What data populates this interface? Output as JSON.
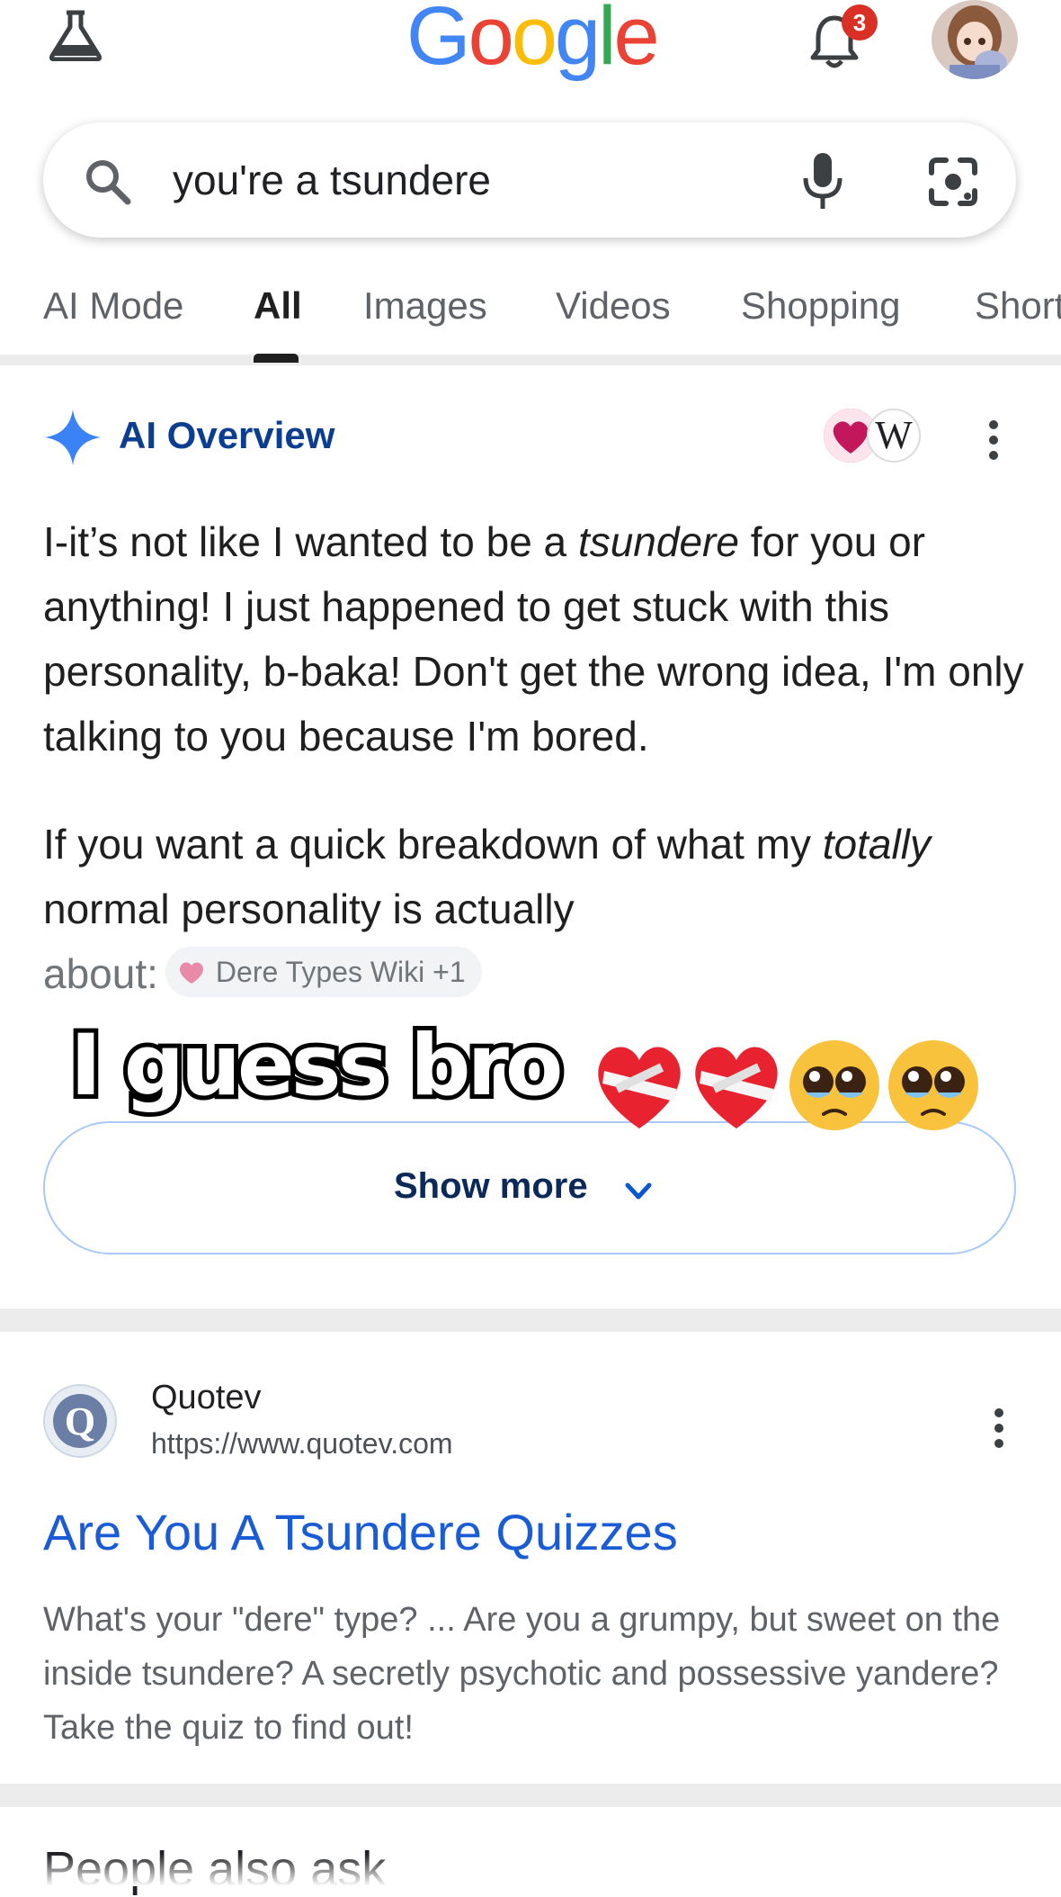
{
  "header": {
    "logo_letters": [
      {
        "ch": "G",
        "color": "#4285F4"
      },
      {
        "ch": "o",
        "color": "#EA4335"
      },
      {
        "ch": "o",
        "color": "#FBBC05"
      },
      {
        "ch": "g",
        "color": "#4285F4"
      },
      {
        "ch": "l",
        "color": "#34A853"
      },
      {
        "ch": "e",
        "color": "#EA4335"
      }
    ],
    "notification_count": "3",
    "icons": [
      "labs-flask-icon",
      "bell-icon",
      "avatar"
    ]
  },
  "search": {
    "query": "you're a tsundere",
    "icons": [
      "search-icon",
      "mic-icon",
      "lens-icon"
    ]
  },
  "tabs": [
    {
      "label": "AI Mode",
      "active": false
    },
    {
      "label": "All",
      "active": true
    },
    {
      "label": "Images",
      "active": false
    },
    {
      "label": "Videos",
      "active": false
    },
    {
      "label": "Shopping",
      "active": false
    },
    {
      "label": "Short",
      "active": false
    }
  ],
  "ai_overview": {
    "title": "AI Overview",
    "source_logo2_letter": "W",
    "p1_a": "I-it’s not like I wanted to be a ",
    "p1_em": "tsundere",
    "p1_b": " for you or anything! I just happened to get stuck with this personality, b-baka! Don't get the wrong idea, I'm only talking to you because I'm bored.",
    "p2_a": "If you want a quick breakdown of what my ",
    "p2_em": "totally",
    "p2_b": " normal personality is actually",
    "p2_about": "about:",
    "source_chip": "Dere Types Wiki +1",
    "show_more": "Show more"
  },
  "overlay_caption": "I guess bro",
  "result": {
    "site_name": "Quotev",
    "url": "https://www.quotev.com",
    "favicon_letter": "Q",
    "title": "Are You A Tsundere Quizzes",
    "snippet": "What's your \"dere\" type? ... Are you a grumpy, but sweet on the inside tsundere? A secretly psychotic and possessive yandere? Take the quiz to find out!"
  },
  "next_section_heading": "People also ask",
  "colors": {
    "accent_blue": "#1a5bd6",
    "ai_title": "#0b3d91",
    "badge_red": "#d93025"
  }
}
